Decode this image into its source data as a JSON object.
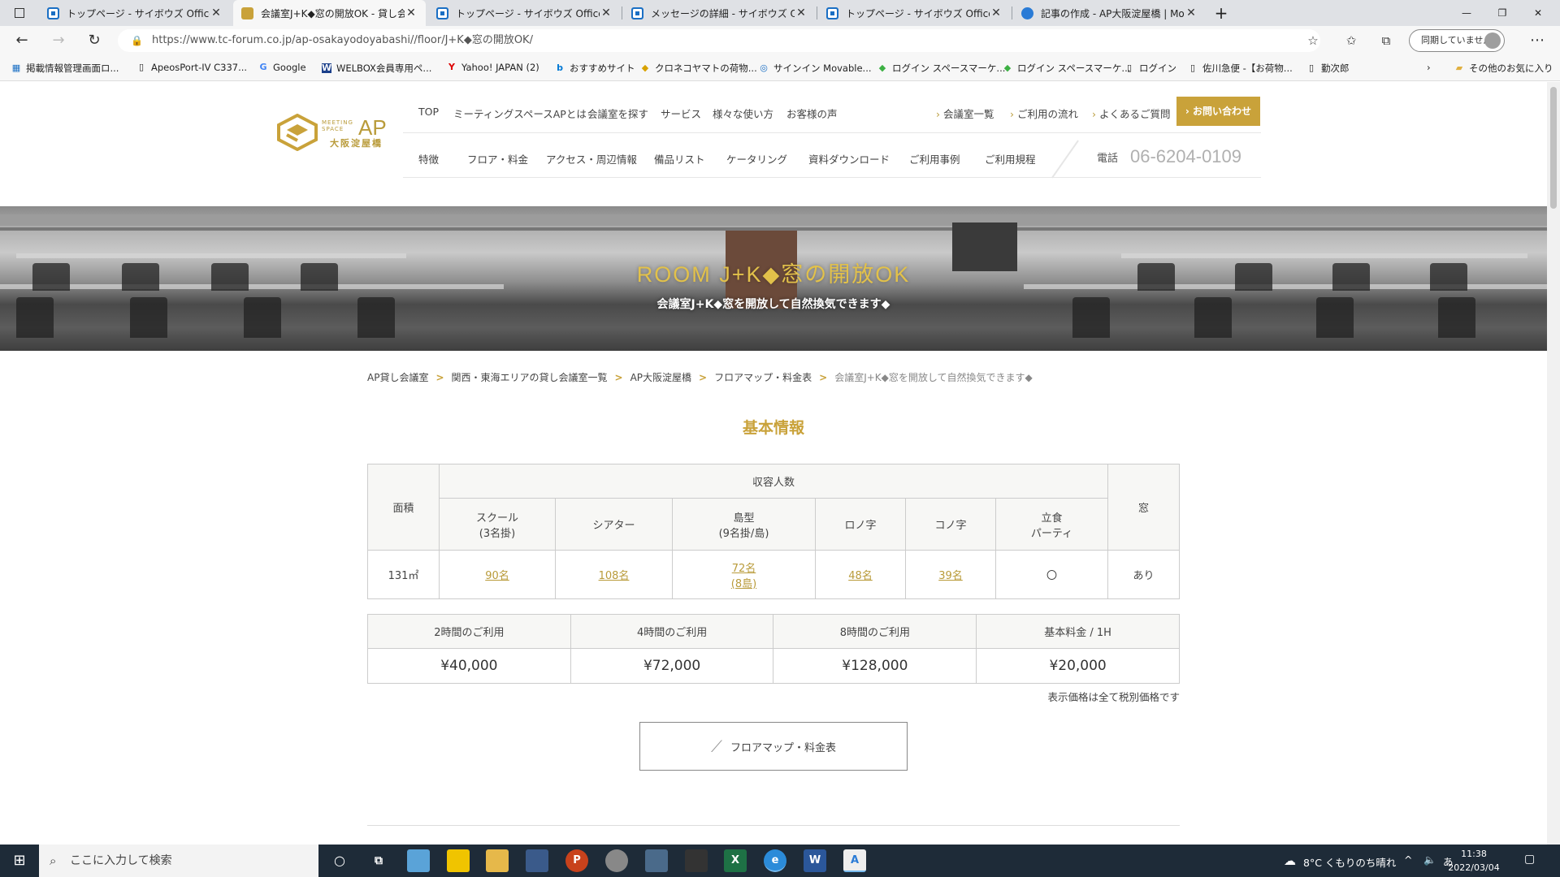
{
  "browser": {
    "tabs": [
      {
        "title": "トップページ - サイボウズ Office",
        "active": false
      },
      {
        "title": "会議室J+K◆窓の開放OK - 貸し会",
        "active": true
      },
      {
        "title": "トップページ - サイボウズ Office",
        "active": false
      },
      {
        "title": "メッセージの詳細 - サイボウズ Office",
        "active": false
      },
      {
        "title": "トップページ - サイボウズ Office",
        "active": false
      },
      {
        "title": "記事の作成 - AP大阪淀屋橋 | Mo",
        "active": false
      }
    ],
    "new_tab": "+",
    "url": "https://www.tc-forum.co.jp/ap-osakayodoyabashi//floor/J+K◆窓の開放OK/",
    "sync_label": "同期していません",
    "bookmarks": [
      "掲載情報管理画面ロ...",
      "ApeosPort-IV C337...",
      "Google",
      "WELBOX会員専用ペ...",
      "Yahoo! JAPAN (2)",
      "おすすめサイト",
      "クロネコヤマトの荷物...",
      "サインイン Movable...",
      "ログイン スペースマーケ...",
      "ログイン スペースマーケ...",
      "ログイン",
      "佐川急便 -【お荷物...",
      "勤次郎"
    ],
    "other_favorites": "その他のお気に入り"
  },
  "site": {
    "logo": {
      "sub": "MEETING SPACE",
      "ap": "AP",
      "jp": "大阪淀屋橋"
    },
    "nav_top": [
      "TOP",
      "ミーティングスペースAPとは",
      "会議室を探す",
      "サービス",
      "様々な使い方",
      "お客様の声"
    ],
    "nav_links": [
      "会議室一覧",
      "ご利用の流れ",
      "よくあるご質問"
    ],
    "contact_button": "お問い合わせ",
    "nav_sub": [
      "特徴",
      "フロア・料金",
      "アクセス・周辺情報",
      "備品リスト",
      "ケータリング",
      "資料ダウンロード",
      "ご利用事例",
      "ご利用規程"
    ],
    "tel_label": "電話",
    "tel": "06-6204-0109"
  },
  "hero": {
    "title": "ROOM J+K◆窓の開放OK",
    "subtitle": "会議室J+K◆窓を開放して自然換気できます◆"
  },
  "breadcrumb": [
    "AP貸し会議室",
    "関西・東海エリアの貸し会議室一覧",
    "AP大阪淀屋橋",
    "フロアマップ・料金表",
    "会議室J+K◆窓を開放して自然換気できます◆"
  ],
  "section_title": "基本情報",
  "capacity_table": {
    "area_header": "面積",
    "capacity_header": "収容人数",
    "window_header": "窓",
    "columns": [
      {
        "line1": "スクール",
        "line2": "(3名掛)"
      },
      {
        "line1": "シアター",
        "line2": ""
      },
      {
        "line1": "島型",
        "line2": "(9名掛/島)"
      },
      {
        "line1": "ロノ字",
        "line2": ""
      },
      {
        "line1": "コノ字",
        "line2": ""
      },
      {
        "line1": "立食",
        "line2": "パーティ"
      }
    ],
    "area": "131㎡",
    "values": [
      {
        "line1": "90名",
        "line2": ""
      },
      {
        "line1": "108名",
        "line2": ""
      },
      {
        "line1": "72名",
        "line2": "(8島)"
      },
      {
        "line1": "48名",
        "line2": ""
      },
      {
        "line1": "39名",
        "line2": ""
      },
      {
        "line1": "〇",
        "line2": ""
      }
    ],
    "window": "あり"
  },
  "price_table": {
    "headers": [
      "2時間のご利用",
      "4時間のご利用",
      "8時間のご利用",
      "基本料金 / 1H"
    ],
    "values": [
      "¥40,000",
      "¥72,000",
      "¥128,000",
      "¥20,000"
    ]
  },
  "note": "表示価格は全て税別価格です",
  "pdf_button": "フロアマップ・料金表",
  "taskbar": {
    "search_placeholder": "ここに入力して検索",
    "weather": "8°C くもりのち晴れ",
    "ime": "あ",
    "time": "11:38",
    "date": "2022/03/04"
  }
}
